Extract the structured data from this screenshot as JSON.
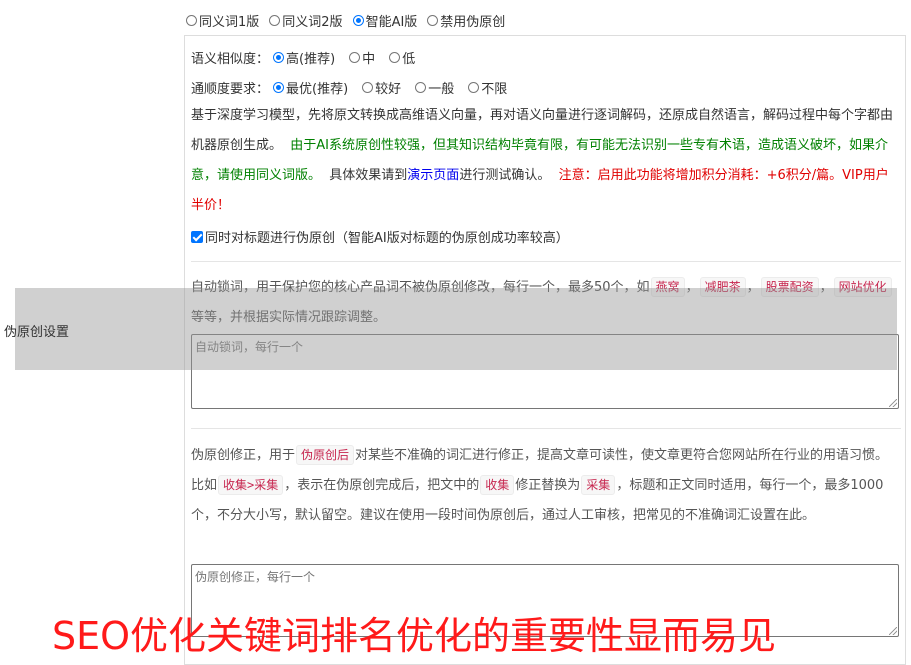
{
  "version_options": {
    "items": [
      "同义词1版",
      "同义词2版",
      "智能AI版",
      "禁用伪原创"
    ],
    "selected_index": 2
  },
  "similarity": {
    "label": "语义相似度：",
    "options": [
      "高(推荐)",
      "中",
      "低"
    ],
    "selected_index": 0
  },
  "fluency": {
    "label": "通顺度要求：",
    "options": [
      "最优(推荐)",
      "较好",
      "一般",
      "不限"
    ],
    "selected_index": 0
  },
  "ai_desc": {
    "p1": "基于深度学习模型，先将原文转换成高维语义向量，再对语义向量进行逐词解码，还原成自然语言，解码过程中每个字都由机器原创生成。",
    "p2_green": "由于AI系统原创性较强，但其知识结构毕竟有限，有可能无法识别一些专有术语，造成语义破坏，如果介意，请使用同义词版。",
    "p3a": "具体效果请到",
    "p3_link": "演示页面",
    "p3b": "进行测试确认。",
    "p4_red": "注意：启用此功能将增加积分消耗：+6积分/篇。VIP用户半价！"
  },
  "title_check": {
    "label": "同时对标题进行伪原创（智能AI版对标题的伪原创成功率较高）",
    "checked": true
  },
  "lock_words": {
    "desc_a": "自动锁词，用于保护您的核心产品词不被伪原创修改，每行一个，最多50个，如",
    "examples": [
      "燕窝",
      "减肥茶",
      "股票配资",
      "网站优化"
    ],
    "desc_b": "等等，并根据实际情况跟踪调整。",
    "placeholder": "自动锁词，每行一个"
  },
  "correction": {
    "desc_a": "伪原创修正，用于",
    "chip1": "伪原创后",
    "desc_b": "对某些不准确的词汇进行修正，提高文章可读性，使文章更符合您网站所在行业的用语习惯。比如",
    "chip2": "收集>采集",
    "desc_c": "，表示在伪原创完成后，把文中的",
    "chip3": "收集",
    "desc_d": "修正替换为",
    "chip4": "采集",
    "desc_e": "，标题和正文同时适用，每行一个，最多1000个，不分大小写，默认留空。建议在使用一段时间伪原创后，通过人工审核，把常见的不准确词汇设置在此。",
    "placeholder": "伪原创修正，每行一个"
  },
  "side_label": "伪原创设置",
  "headline": "SEO优化关键词排名优化的重要性显而易见",
  "colors": {
    "accent": "#0075ff",
    "green_text": "#008000",
    "red_text": "#e00000",
    "headline": "#ff1a1a",
    "link": "#0000ee"
  }
}
